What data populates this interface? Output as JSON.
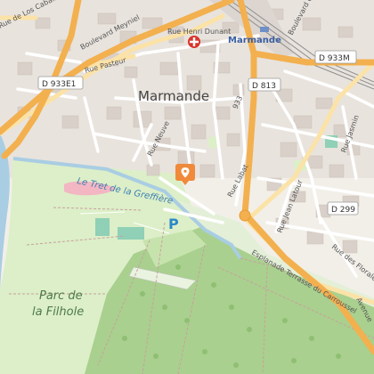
{
  "map": {
    "places": {
      "town": "Marmande",
      "station": "Marmande",
      "park_line1": "Parc de",
      "park_line2": "la Filhole"
    },
    "streets": {
      "caballeros": "Rue de Los Caballeros",
      "meyniel": "Boulevard Meyniel",
      "dunant": "Rue Henri Dunant",
      "liberte": "Boulevard de la Liberté",
      "pasteur": "Rue Pasteur",
      "neuve": "Rue Neuve",
      "labat": "Rue Labat",
      "jasmin": "Rue Jasmin",
      "latour": "Rue Jean Latour",
      "florales": "Rue des Florales",
      "esplanade": "Esplanade Terrasse du Carroussel",
      "avenue": "Avenue",
      "street_933": "933",
      "canal": "Le Tret de la Greffière"
    },
    "shields": {
      "d933e1": "D 933E1",
      "d813": "D 813",
      "d933m": "D 933M",
      "d299": "D 299"
    },
    "poi": {
      "parking": "P",
      "hospital_icon": "hospital-cross-icon",
      "marker_icon": "location-pin-icon"
    },
    "colors": {
      "main_road": "#f3b04f",
      "secondary_road": "#fbe2a7",
      "river": "#a9cde3",
      "park": "#dcefc8",
      "forest": "#a9d08e",
      "building": "#d9d0c9",
      "marker": "#f08a3a",
      "hospital": "#d9342b",
      "parking": "#2a88c8"
    }
  }
}
